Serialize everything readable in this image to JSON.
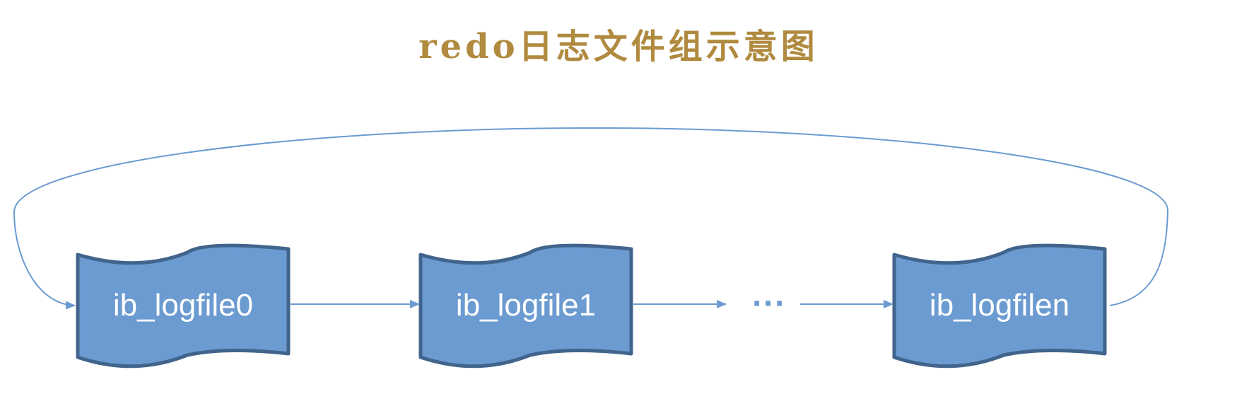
{
  "title": "redo日志文件组示意图",
  "nodes": [
    {
      "label": "ib_logfile0"
    },
    {
      "label": "ib_logfile1"
    },
    {
      "label": "ib_logfilen"
    }
  ],
  "ellipsis": "···",
  "colors": {
    "title": "#b08a3e",
    "node_fill": "#6b9bd1",
    "node_stroke": "#41648c",
    "connector": "#6b9bd1"
  }
}
